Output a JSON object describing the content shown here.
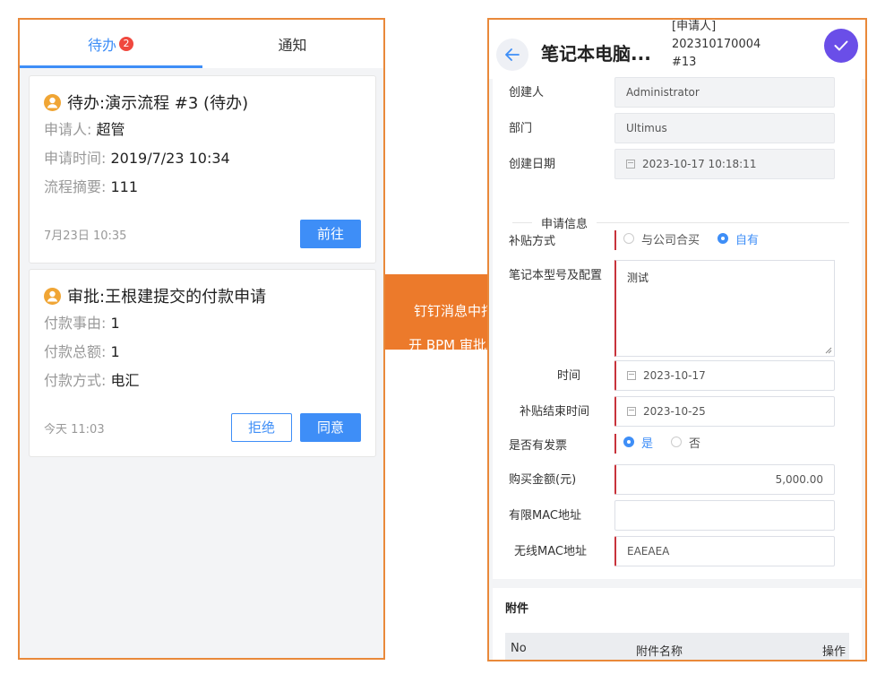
{
  "left": {
    "tabs": [
      {
        "label": "待办",
        "badge": "2"
      },
      {
        "label": "通知"
      }
    ],
    "cards": [
      {
        "title": "待办:演示流程 #3 (待办)",
        "rows": [
          {
            "k": "申请人: ",
            "v": "超管"
          },
          {
            "k": "申请时间: ",
            "v": "2019/7/23 10:34"
          },
          {
            "k": "流程摘要: ",
            "v": "111"
          }
        ],
        "time": "7月23日 10:35",
        "go_label": "前往"
      },
      {
        "title": "审批:王根建提交的付款申请",
        "rows": [
          {
            "k": "付款事由: ",
            "v": "1"
          },
          {
            "k": "付款总额: ",
            "v": "1"
          },
          {
            "k": "付款方式: ",
            "v": "电汇"
          }
        ],
        "time": "今天 11:03",
        "reject_label": "拒绝",
        "agree_label": "同意"
      }
    ]
  },
  "arrow": {
    "line1": "钉钉消息中打",
    "line2": "开 BPM 审批单"
  },
  "right": {
    "header": {
      "title": "笔记本电脑...",
      "sub_line1": "[申请人]",
      "sub_line2": "202310170004",
      "sub_line3": "#13"
    },
    "form": {
      "creator_label": "创建人",
      "creator_value": "Administrator",
      "dept_label": "部门",
      "dept_value": "Ultimus",
      "created_date_label": "创建日期",
      "created_date_value": "2023-10-17 10:18:11",
      "section_title": "申请信息",
      "subsidy_label": "补贴方式",
      "subsidy_opt1": "与公司合买",
      "subsidy_opt2": "自有",
      "model_label": "笔记本型号及配置",
      "model_value": "测试",
      "start_label": "时间",
      "start_value": "2023-10-17",
      "end_label": "补贴结束时间",
      "end_value": "2023-10-25",
      "invoice_label": "是否有发票",
      "invoice_yes": "是",
      "invoice_no": "否",
      "amount_label": "购买金额(元)",
      "amount_value": "5,000.00",
      "wired_mac_label": "有限MAC地址",
      "wired_mac_value": "",
      "wireless_mac_label": "无线MAC地址",
      "wireless_mac_value": "EAEAEA"
    },
    "attachments": {
      "title": "附件",
      "col_no": "No",
      "col_name": "附件名称",
      "col_action": "操作"
    }
  },
  "colors": {
    "accent": "#3e8ef7",
    "frame": "#e9893a",
    "arrow": "#ec7a2b",
    "confirm": "#6a4ee8",
    "required": "#c8333b"
  }
}
